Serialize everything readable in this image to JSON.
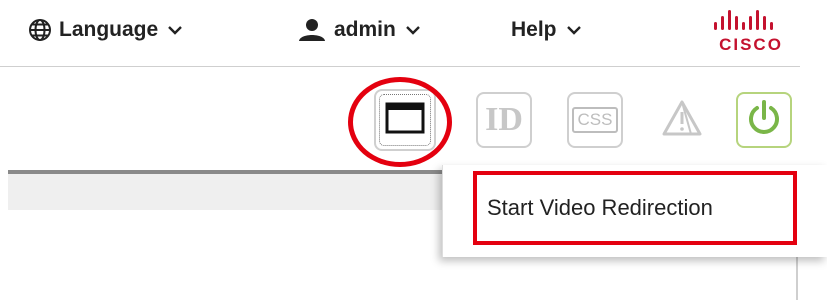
{
  "header": {
    "language_label": "Language",
    "user_label": "admin",
    "help_label": "Help",
    "logo_text": "CISCO",
    "logo_color": "#c4122f"
  },
  "toolbar": {
    "buttons": [
      {
        "name": "video-redirection-button",
        "icon": "window-icon"
      },
      {
        "name": "id-button",
        "icon": "id-icon",
        "text": "ID"
      },
      {
        "name": "css-button",
        "icon": "css-icon",
        "text": "CSS"
      },
      {
        "name": "warning-button",
        "icon": "warning-icon"
      },
      {
        "name": "power-button",
        "icon": "power-icon",
        "accent": "#7ab648"
      }
    ]
  },
  "dropdown": {
    "items": [
      {
        "label": "Start Video Redirection"
      }
    ]
  },
  "highlight_color": "#e4000f"
}
